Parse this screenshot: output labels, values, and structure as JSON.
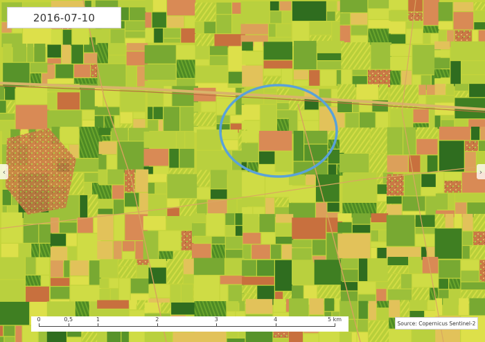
{
  "date_label": "2016-07-10",
  "source_label": "Source: Copernicus Sentinel-2",
  "scale_bar": {
    "labels": [
      "0",
      "0,5",
      "1",
      "2",
      "3",
      "4",
      "5 km"
    ],
    "values_km": [
      0,
      0.5,
      1,
      2,
      3,
      4,
      5
    ]
  },
  "nav": {
    "prev_icon": "‹",
    "next_icon": "›"
  },
  "highlight": {
    "shape": "ellipse",
    "color": "#5aa2d8"
  },
  "colors": {
    "dense_vegetation": "#2e6b1e",
    "vegetation": "#5f9a2a",
    "sparse_vegetation": "#c8d83c",
    "bare_soil": "#d98a55",
    "urban": "#c8703e"
  }
}
